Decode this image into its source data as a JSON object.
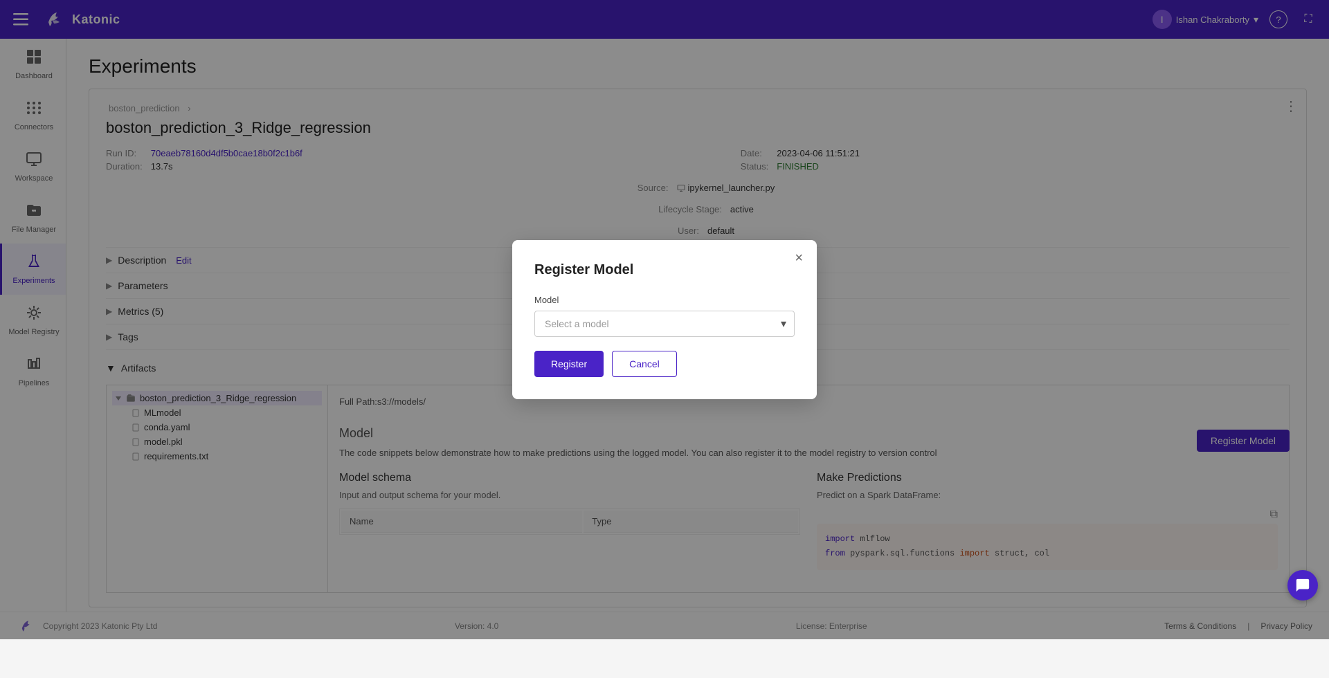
{
  "app": {
    "name": "Katonic"
  },
  "topbar": {
    "menu_icon": "☰",
    "user_name": "Ishan Chakraborty",
    "help_icon": "?",
    "expand_icon": "⛶"
  },
  "sidebar": {
    "items": [
      {
        "id": "dashboard",
        "label": "Dashboard",
        "icon": "⊞"
      },
      {
        "id": "connectors",
        "label": "Connectors",
        "icon": "⠿"
      },
      {
        "id": "workspace",
        "label": "Workspace",
        "icon": "🖥"
      },
      {
        "id": "file-manager",
        "label": "File Manager",
        "icon": "★"
      },
      {
        "id": "experiments",
        "label": "Experiments",
        "icon": "🧪",
        "active": true
      },
      {
        "id": "model-registry",
        "label": "Model Registry",
        "icon": "⟳"
      },
      {
        "id": "pipelines",
        "label": "Pipelines",
        "icon": "⌥"
      }
    ]
  },
  "page": {
    "title": "Experiments",
    "breadcrumb": "boston_prediction",
    "breadcrumb_separator": "›",
    "experiment_title": "boston_prediction_3_Ridge_regression",
    "run_id_label": "Run ID:",
    "run_id_value": "70eaeb78160d4df5b0cae18b0f2c1b6f",
    "date_label": "Date:",
    "date_value": "2023-04-06 11:51:21",
    "source_label": "Source:",
    "source_icon": "🖥",
    "source_value": "ipykernel_launcher.py",
    "user_label": "User:",
    "user_value": "default",
    "duration_label": "Duration:",
    "duration_value": "13.7s",
    "status_label": "Status:",
    "status_value": "FINISHED",
    "lifecycle_label": "Lifecycle Stage:",
    "lifecycle_value": "active",
    "sections": [
      {
        "id": "description",
        "label": "Description",
        "action": "Edit",
        "collapsed": true
      },
      {
        "id": "parameters",
        "label": "Parameters",
        "collapsed": true
      },
      {
        "id": "metrics",
        "label": "Metrics (5)",
        "collapsed": true
      },
      {
        "id": "tags",
        "label": "Tags",
        "collapsed": true
      }
    ],
    "artifacts_label": "Artifacts",
    "artifacts_expanded": true,
    "tree": {
      "root": "boston_prediction_3_Ridge_regression",
      "children": [
        "MLmodel",
        "conda.yaml",
        "model.pkl",
        "requirements.txt"
      ]
    },
    "full_path": "Full Path:s3://models/",
    "model_section_title": "Model",
    "model_desc": "The code snippets below demonstrate how to make predictions using the logged model. You can also register it to the model registry to version control",
    "register_model_btn": "Register Model",
    "model_schema_title": "Model schema",
    "model_schema_desc": "Input and output schema for your model.",
    "schema_columns": [
      "Name",
      "Type"
    ],
    "make_predictions_title": "Make Predictions",
    "make_predictions_desc": "Predict on a Spark DataFrame:",
    "code_line1": "import mlflow",
    "code_line2": "from pyspark.sql.functions import struct, col"
  },
  "dialog": {
    "title": "Register Model",
    "close_icon": "×",
    "model_label": "Model",
    "model_placeholder": "Select a model",
    "register_btn": "Register",
    "cancel_btn": "Cancel"
  },
  "footer": {
    "copyright": "Copyright 2023 Katonic Pty Ltd",
    "version_label": "Version: 4.0",
    "license_label": "License: Enterprise",
    "terms_link": "Terms & Conditions",
    "separator": "|",
    "privacy_link": "Privacy Policy"
  }
}
